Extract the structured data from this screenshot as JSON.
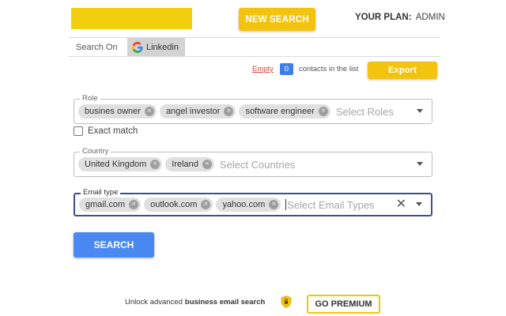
{
  "header": {
    "new_search_label": "NEW SEARCH",
    "plan_label": "YOUR PLAN:",
    "plan_value": "ADMIN",
    "logo_color": "#f2cf0d"
  },
  "tabs": {
    "search_on_label": "Search On",
    "linkedin_label": "Linkedin"
  },
  "contacts": {
    "empty_label": "Empty",
    "count": "0",
    "contacts_text": "contacts in the list",
    "export_label": "Export"
  },
  "role": {
    "legend": "Role",
    "chips": [
      "busines owner",
      "angel investor",
      "software engineer"
    ],
    "placeholder": "Select Roles"
  },
  "exact_match": {
    "label": "Exact match",
    "checked": false
  },
  "country": {
    "legend": "Country",
    "chips": [
      "United Kingdom",
      "Ireland"
    ],
    "placeholder": "Select Countries"
  },
  "email_type": {
    "legend": "Email type",
    "chips": [
      "gmail.com",
      "outlook.com",
      "yahoo.com"
    ],
    "placeholder": "Select Email Types"
  },
  "search_button_label": "SEARCH",
  "premium": {
    "text": "Unlock advanced",
    "bold_text": "business email search",
    "button_label": "GO PREMIUM"
  },
  "colors": {
    "accent_yellow": "#f2c40f",
    "primary_blue": "#4b89f2",
    "badge_blue": "#3f7ee8",
    "danger_red": "#d9473f"
  }
}
